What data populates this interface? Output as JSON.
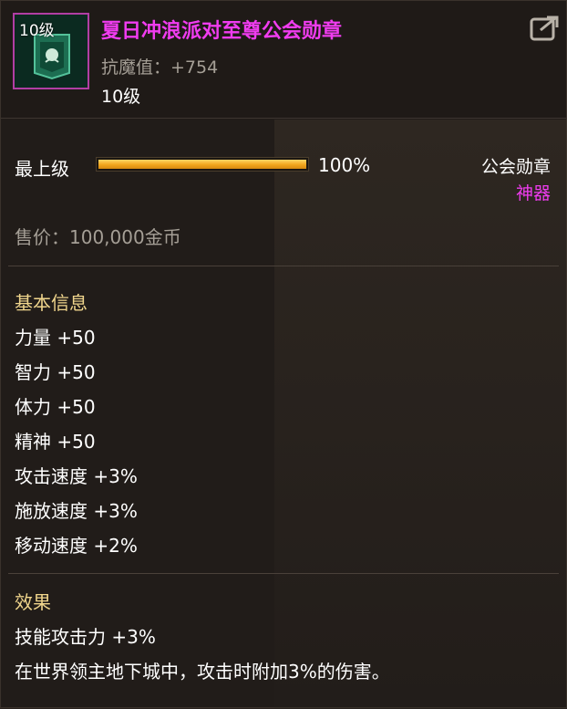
{
  "item": {
    "level_badge": "10级",
    "name": "夏日冲浪派对至尊公会勋章",
    "resist_label": "抗魔值：",
    "resist_value": "+754",
    "level": "10级"
  },
  "grade": {
    "label": "最上级",
    "percent_text": "100%",
    "fill_fraction": 1.0
  },
  "type": {
    "category": "公会勋章",
    "rarity": "神器"
  },
  "price": {
    "label": "售价：",
    "value": "100,000金币"
  },
  "basic_info": {
    "title": "基本信息",
    "stats": [
      "力量 +50",
      "智力 +50",
      "体力 +50",
      "精神 +50",
      "攻击速度 +3%",
      "施放速度 +3%",
      "移动速度 +2%"
    ]
  },
  "effect": {
    "title": "效果",
    "lines": [
      "技能攻击力 +3%",
      "在世界领主地下城中，攻击时附加3%的伤害。"
    ]
  },
  "colors": {
    "rarity": "#f03cf0",
    "section_title": "#f0d58c",
    "grade_bar": "#f0a51e",
    "icon_border": "#b13ea4"
  },
  "icons": {
    "share": "share-icon",
    "item": "guild-medal-icon"
  }
}
